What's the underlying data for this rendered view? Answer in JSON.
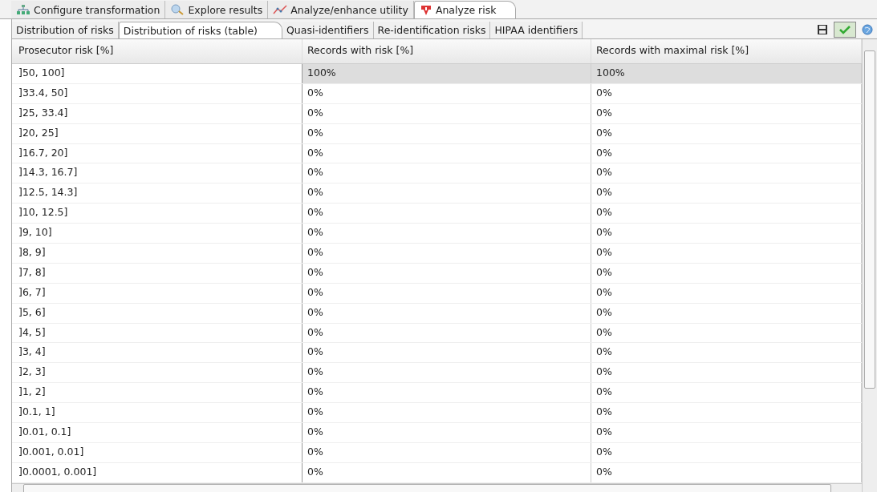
{
  "main_tabs": [
    {
      "label": "Configure transformation",
      "kind": "config",
      "selected": false
    },
    {
      "label": "Explore results",
      "kind": "explore",
      "selected": false
    },
    {
      "label": "Analyze/enhance utility",
      "kind": "utility",
      "selected": false
    },
    {
      "label": "Analyze risk",
      "kind": "risk",
      "selected": true
    }
  ],
  "sub_tabs": [
    {
      "label": "Distribution of risks",
      "selected": false
    },
    {
      "label": "Distribution of risks (table)",
      "selected": true
    },
    {
      "label": "Quasi-identifiers",
      "selected": false
    },
    {
      "label": "Re-identification risks",
      "selected": false
    },
    {
      "label": "HIPAA identifiers",
      "selected": false
    }
  ],
  "toolbar": [
    {
      "kind": "save",
      "on": false
    },
    {
      "kind": "check",
      "on": true
    },
    {
      "kind": "help",
      "on": false
    }
  ],
  "table": {
    "columns": [
      "Prosecutor risk [%]",
      "Records with risk [%]",
      "Records with maximal risk [%]"
    ],
    "rows": [
      {
        "cells": [
          "]50, 100]",
          "100%",
          "100%"
        ],
        "selected": true
      },
      {
        "cells": [
          "]33.4, 50]",
          "0%",
          "0%"
        ],
        "selected": false
      },
      {
        "cells": [
          "]25, 33.4]",
          "0%",
          "0%"
        ],
        "selected": false
      },
      {
        "cells": [
          "]20, 25]",
          "0%",
          "0%"
        ],
        "selected": false
      },
      {
        "cells": [
          "]16.7, 20]",
          "0%",
          "0%"
        ],
        "selected": false
      },
      {
        "cells": [
          "]14.3, 16.7]",
          "0%",
          "0%"
        ],
        "selected": false
      },
      {
        "cells": [
          "]12.5, 14.3]",
          "0%",
          "0%"
        ],
        "selected": false
      },
      {
        "cells": [
          "]10, 12.5]",
          "0%",
          "0%"
        ],
        "selected": false
      },
      {
        "cells": [
          "]9, 10]",
          "0%",
          "0%"
        ],
        "selected": false
      },
      {
        "cells": [
          "]8, 9]",
          "0%",
          "0%"
        ],
        "selected": false
      },
      {
        "cells": [
          "]7, 8]",
          "0%",
          "0%"
        ],
        "selected": false
      },
      {
        "cells": [
          "]6, 7]",
          "0%",
          "0%"
        ],
        "selected": false
      },
      {
        "cells": [
          "]5, 6]",
          "0%",
          "0%"
        ],
        "selected": false
      },
      {
        "cells": [
          "]4, 5]",
          "0%",
          "0%"
        ],
        "selected": false
      },
      {
        "cells": [
          "]3, 4]",
          "0%",
          "0%"
        ],
        "selected": false
      },
      {
        "cells": [
          "]2, 3]",
          "0%",
          "0%"
        ],
        "selected": false
      },
      {
        "cells": [
          "]1, 2]",
          "0%",
          "0%"
        ],
        "selected": false
      },
      {
        "cells": [
          "]0.1, 1]",
          "0%",
          "0%"
        ],
        "selected": false
      },
      {
        "cells": [
          "]0.01, 0.1]",
          "0%",
          "0%"
        ],
        "selected": false
      },
      {
        "cells": [
          "]0.001, 0.01]",
          "0%",
          "0%"
        ],
        "selected": false
      },
      {
        "cells": [
          "]0.0001, 0.001]",
          "0%",
          "0%"
        ],
        "selected": false
      }
    ]
  }
}
